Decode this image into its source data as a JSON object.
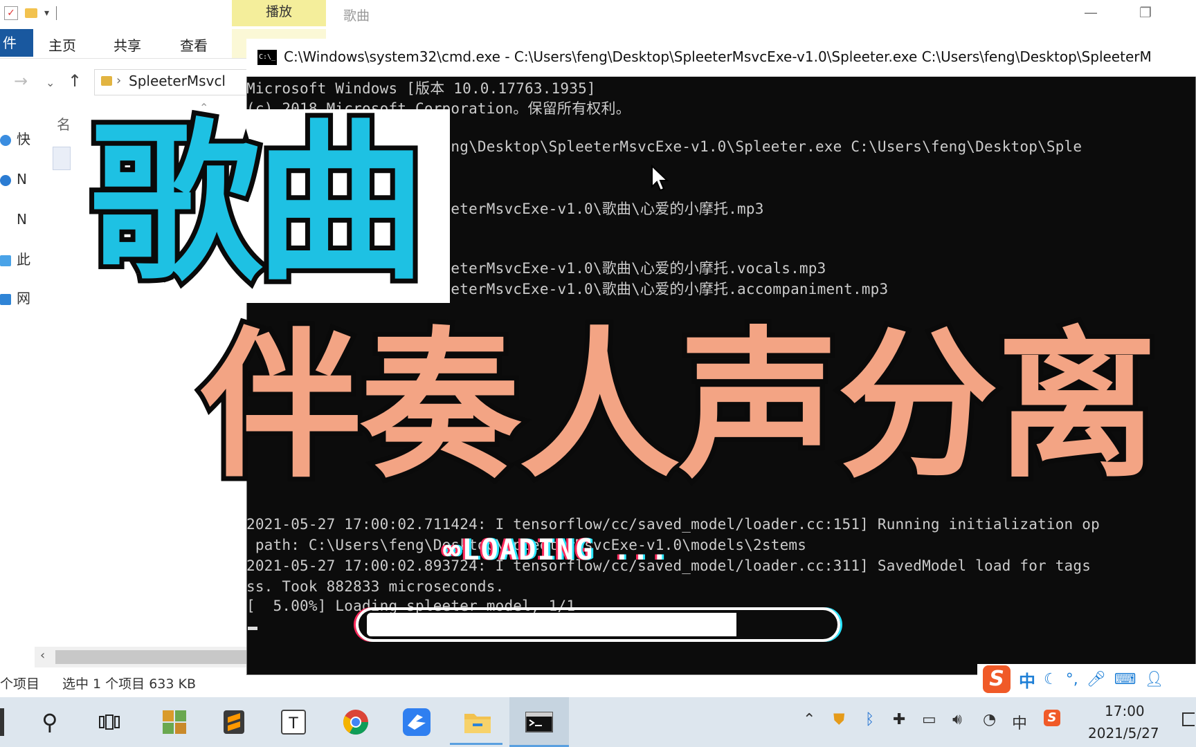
{
  "explorer": {
    "context_tab_top": "播放",
    "context_title": "歌曲",
    "ribbon_file": "件",
    "ribbon_home": "主页",
    "ribbon_share": "共享",
    "ribbon_view": "查看",
    "address_path": "SpleeterMsvcl",
    "column_name": "名",
    "nav_items": [
      "快",
      "N",
      "N",
      "此",
      "网"
    ],
    "status_count": "个项目",
    "status_selected": "选中 1 个项目  633 KB"
  },
  "cmd": {
    "title": "C:\\Windows\\system32\\cmd.exe - C:\\Users\\feng\\Desktop\\SpleeterMsvcExe-v1.0\\Spleeter.exe  C:\\Users\\feng\\Desktop\\SpleeterM",
    "lines": [
      "Microsoft Windows [版本 10.0.17763.1935]",
      "(c) 2018 Microsoft Corporation。保留所有权利。",
      "                  rs\\feng\\Desktop\\SpleeterMsvcExe-v1.0\\Spleeter.exe C:\\Users\\feng\\Desktop\\Sple",
      "                  \\SpleeterMsvcExe-v1.0\\歌曲\\心爱的小摩托.mp3",
      "                  \\SpleeterMsvcExe-v1.0\\歌曲\\心爱的小摩托.vocals.mp3",
      "                  \\SpleeterMsvcExe-v1.0\\歌曲\\心爱的小摩托.accompaniment.mp3"
    ],
    "log_lines": [
      "2021-05-27 17:00:02.711424: I tensorflow/cc/saved_model/loader.cc:151] Running initialization op",
      " path: C:\\Users\\feng\\Desktop\\SpleeterMsvcExe-v1.0\\models\\2stems",
      "2021-05-27 17:00:02.893724: I tensorflow/cc/saved_model/loader.cc:311] SavedModel load for tags",
      "ss. Took 882833 microseconds.",
      "[  5.00%] Loading spleeter model, 1/1"
    ]
  },
  "overlay": {
    "title_line1": "歌曲",
    "title_line2": "伴奏人声分离",
    "loading_text": "LOADING ...",
    "loading_progress": 0.8,
    "colors": {
      "cyan": "#1ec1e3",
      "salmon": "#f3a484"
    }
  },
  "ime": {
    "logo": "S",
    "lang": "中"
  },
  "taskbar": {
    "tray_lang": "中",
    "clock_time": "17:00",
    "clock_date": "2021/5/27",
    "apps": [
      "search-icon",
      "task-view-icon",
      "map-app-icon",
      "sublime-icon",
      "typora-icon",
      "chrome-icon",
      "feishu-icon",
      "file-explorer-icon",
      "cmd-icon"
    ]
  }
}
